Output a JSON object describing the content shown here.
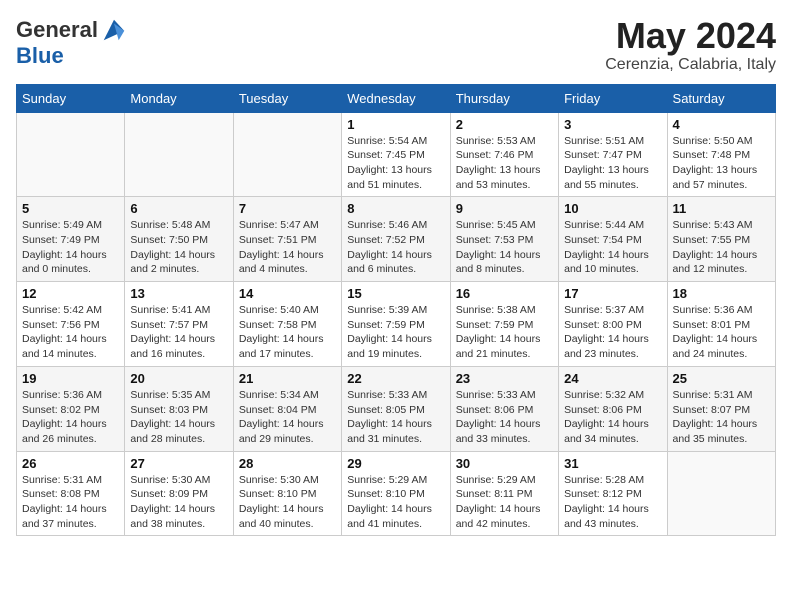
{
  "header": {
    "logo_line1": "General",
    "logo_line2": "Blue",
    "month": "May 2024",
    "location": "Cerenzia, Calabria, Italy"
  },
  "weekdays": [
    "Sunday",
    "Monday",
    "Tuesday",
    "Wednesday",
    "Thursday",
    "Friday",
    "Saturday"
  ],
  "weeks": [
    [
      {
        "day": "",
        "info": ""
      },
      {
        "day": "",
        "info": ""
      },
      {
        "day": "",
        "info": ""
      },
      {
        "day": "1",
        "info": "Sunrise: 5:54 AM\nSunset: 7:45 PM\nDaylight: 13 hours\nand 51 minutes."
      },
      {
        "day": "2",
        "info": "Sunrise: 5:53 AM\nSunset: 7:46 PM\nDaylight: 13 hours\nand 53 minutes."
      },
      {
        "day": "3",
        "info": "Sunrise: 5:51 AM\nSunset: 7:47 PM\nDaylight: 13 hours\nand 55 minutes."
      },
      {
        "day": "4",
        "info": "Sunrise: 5:50 AM\nSunset: 7:48 PM\nDaylight: 13 hours\nand 57 minutes."
      }
    ],
    [
      {
        "day": "5",
        "info": "Sunrise: 5:49 AM\nSunset: 7:49 PM\nDaylight: 14 hours\nand 0 minutes."
      },
      {
        "day": "6",
        "info": "Sunrise: 5:48 AM\nSunset: 7:50 PM\nDaylight: 14 hours\nand 2 minutes."
      },
      {
        "day": "7",
        "info": "Sunrise: 5:47 AM\nSunset: 7:51 PM\nDaylight: 14 hours\nand 4 minutes."
      },
      {
        "day": "8",
        "info": "Sunrise: 5:46 AM\nSunset: 7:52 PM\nDaylight: 14 hours\nand 6 minutes."
      },
      {
        "day": "9",
        "info": "Sunrise: 5:45 AM\nSunset: 7:53 PM\nDaylight: 14 hours\nand 8 minutes."
      },
      {
        "day": "10",
        "info": "Sunrise: 5:44 AM\nSunset: 7:54 PM\nDaylight: 14 hours\nand 10 minutes."
      },
      {
        "day": "11",
        "info": "Sunrise: 5:43 AM\nSunset: 7:55 PM\nDaylight: 14 hours\nand 12 minutes."
      }
    ],
    [
      {
        "day": "12",
        "info": "Sunrise: 5:42 AM\nSunset: 7:56 PM\nDaylight: 14 hours\nand 14 minutes."
      },
      {
        "day": "13",
        "info": "Sunrise: 5:41 AM\nSunset: 7:57 PM\nDaylight: 14 hours\nand 16 minutes."
      },
      {
        "day": "14",
        "info": "Sunrise: 5:40 AM\nSunset: 7:58 PM\nDaylight: 14 hours\nand 17 minutes."
      },
      {
        "day": "15",
        "info": "Sunrise: 5:39 AM\nSunset: 7:59 PM\nDaylight: 14 hours\nand 19 minutes."
      },
      {
        "day": "16",
        "info": "Sunrise: 5:38 AM\nSunset: 7:59 PM\nDaylight: 14 hours\nand 21 minutes."
      },
      {
        "day": "17",
        "info": "Sunrise: 5:37 AM\nSunset: 8:00 PM\nDaylight: 14 hours\nand 23 minutes."
      },
      {
        "day": "18",
        "info": "Sunrise: 5:36 AM\nSunset: 8:01 PM\nDaylight: 14 hours\nand 24 minutes."
      }
    ],
    [
      {
        "day": "19",
        "info": "Sunrise: 5:36 AM\nSunset: 8:02 PM\nDaylight: 14 hours\nand 26 minutes."
      },
      {
        "day": "20",
        "info": "Sunrise: 5:35 AM\nSunset: 8:03 PM\nDaylight: 14 hours\nand 28 minutes."
      },
      {
        "day": "21",
        "info": "Sunrise: 5:34 AM\nSunset: 8:04 PM\nDaylight: 14 hours\nand 29 minutes."
      },
      {
        "day": "22",
        "info": "Sunrise: 5:33 AM\nSunset: 8:05 PM\nDaylight: 14 hours\nand 31 minutes."
      },
      {
        "day": "23",
        "info": "Sunrise: 5:33 AM\nSunset: 8:06 PM\nDaylight: 14 hours\nand 33 minutes."
      },
      {
        "day": "24",
        "info": "Sunrise: 5:32 AM\nSunset: 8:06 PM\nDaylight: 14 hours\nand 34 minutes."
      },
      {
        "day": "25",
        "info": "Sunrise: 5:31 AM\nSunset: 8:07 PM\nDaylight: 14 hours\nand 35 minutes."
      }
    ],
    [
      {
        "day": "26",
        "info": "Sunrise: 5:31 AM\nSunset: 8:08 PM\nDaylight: 14 hours\nand 37 minutes."
      },
      {
        "day": "27",
        "info": "Sunrise: 5:30 AM\nSunset: 8:09 PM\nDaylight: 14 hours\nand 38 minutes."
      },
      {
        "day": "28",
        "info": "Sunrise: 5:30 AM\nSunset: 8:10 PM\nDaylight: 14 hours\nand 40 minutes."
      },
      {
        "day": "29",
        "info": "Sunrise: 5:29 AM\nSunset: 8:10 PM\nDaylight: 14 hours\nand 41 minutes."
      },
      {
        "day": "30",
        "info": "Sunrise: 5:29 AM\nSunset: 8:11 PM\nDaylight: 14 hours\nand 42 minutes."
      },
      {
        "day": "31",
        "info": "Sunrise: 5:28 AM\nSunset: 8:12 PM\nDaylight: 14 hours\nand 43 minutes."
      },
      {
        "day": "",
        "info": ""
      }
    ]
  ]
}
